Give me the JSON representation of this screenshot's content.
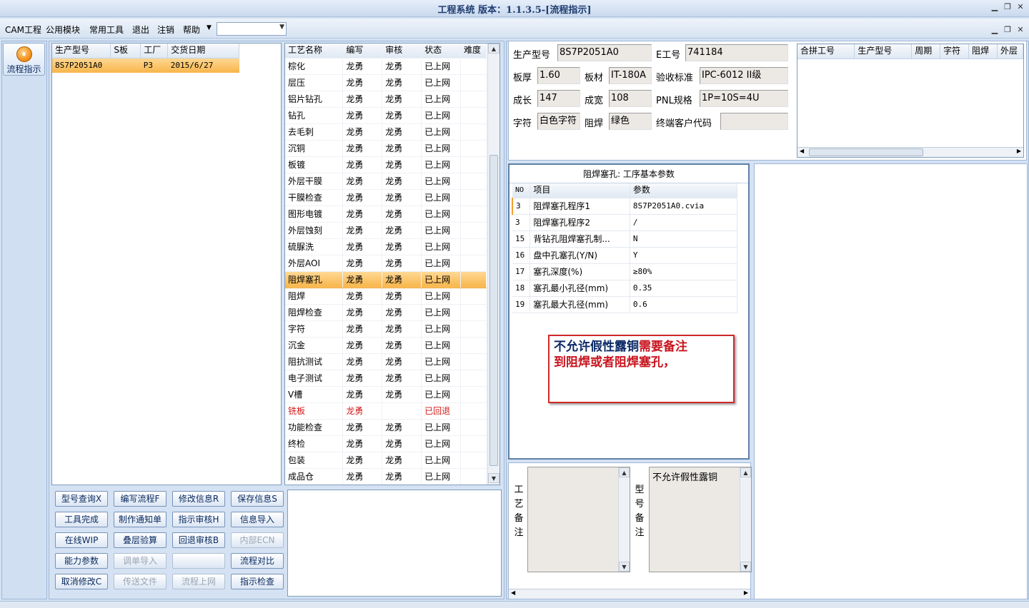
{
  "window": {
    "title": "工程系统  版本：1.1.3.5-[流程指示]"
  },
  "menu": {
    "items": [
      "CAM工程",
      "公用模块",
      "常用工具",
      "退出",
      "注销",
      "帮助"
    ],
    "combo_value": ""
  },
  "nav": {
    "button_label": "流程指示"
  },
  "orders": {
    "headers": [
      "生产型号",
      "S板",
      "工厂",
      "交货日期"
    ],
    "rows": [
      {
        "model": "8S7P2051A0",
        "s": "",
        "factory": "P3",
        "date": "2015/6/27"
      }
    ]
  },
  "process": {
    "headers": [
      "工艺名称",
      "编写",
      "审核",
      "状态",
      "难度"
    ],
    "rows": [
      {
        "name": "棕化",
        "author": "龙勇",
        "reviewer": "龙勇",
        "status": "已上网"
      },
      {
        "name": "层压",
        "author": "龙勇",
        "reviewer": "龙勇",
        "status": "已上网"
      },
      {
        "name": "铝片钻孔",
        "author": "龙勇",
        "reviewer": "龙勇",
        "status": "已上网"
      },
      {
        "name": "钻孔",
        "author": "龙勇",
        "reviewer": "龙勇",
        "status": "已上网"
      },
      {
        "name": "去毛刺",
        "author": "龙勇",
        "reviewer": "龙勇",
        "status": "已上网"
      },
      {
        "name": "沉铜",
        "author": "龙勇",
        "reviewer": "龙勇",
        "status": "已上网"
      },
      {
        "name": "板镀",
        "author": "龙勇",
        "reviewer": "龙勇",
        "status": "已上网"
      },
      {
        "name": "外层干膜",
        "author": "龙勇",
        "reviewer": "龙勇",
        "status": "已上网"
      },
      {
        "name": "干膜检查",
        "author": "龙勇",
        "reviewer": "龙勇",
        "status": "已上网"
      },
      {
        "name": "图形电镀",
        "author": "龙勇",
        "reviewer": "龙勇",
        "status": "已上网"
      },
      {
        "name": "外层蚀刻",
        "author": "龙勇",
        "reviewer": "龙勇",
        "status": "已上网"
      },
      {
        "name": "硫脲洗",
        "author": "龙勇",
        "reviewer": "龙勇",
        "status": "已上网"
      },
      {
        "name": "外层AOI",
        "author": "龙勇",
        "reviewer": "龙勇",
        "status": "已上网"
      },
      {
        "name": "阻焊塞孔",
        "author": "龙勇",
        "reviewer": "龙勇",
        "status": "已上网",
        "selected": true
      },
      {
        "name": "阻焊",
        "author": "龙勇",
        "reviewer": "龙勇",
        "status": "已上网"
      },
      {
        "name": "阻焊检查",
        "author": "龙勇",
        "reviewer": "龙勇",
        "status": "已上网"
      },
      {
        "name": "字符",
        "author": "龙勇",
        "reviewer": "龙勇",
        "status": "已上网"
      },
      {
        "name": "沉金",
        "author": "龙勇",
        "reviewer": "龙勇",
        "status": "已上网"
      },
      {
        "name": "阻抗测试",
        "author": "龙勇",
        "reviewer": "龙勇",
        "status": "已上网"
      },
      {
        "name": "电子测试",
        "author": "龙勇",
        "reviewer": "龙勇",
        "status": "已上网"
      },
      {
        "name": "V槽",
        "author": "龙勇",
        "reviewer": "龙勇",
        "status": "已上网"
      },
      {
        "name": "铣板",
        "author": "龙勇",
        "reviewer": "",
        "status": "已回退",
        "returned": true
      },
      {
        "name": "功能检查",
        "author": "龙勇",
        "reviewer": "龙勇",
        "status": "已上网"
      },
      {
        "name": "终检",
        "author": "龙勇",
        "reviewer": "龙勇",
        "status": "已上网"
      },
      {
        "name": "包装",
        "author": "龙勇",
        "reviewer": "龙勇",
        "status": "已上网"
      },
      {
        "name": "成品仓",
        "author": "龙勇",
        "reviewer": "龙勇",
        "status": "已上网"
      }
    ]
  },
  "buttons": [
    {
      "label": "型号查询X",
      "enabled": true
    },
    {
      "label": "编写流程F",
      "enabled": true
    },
    {
      "label": "修改信息R",
      "enabled": true
    },
    {
      "label": "保存信息S",
      "enabled": true
    },
    {
      "label": "工具完成",
      "enabled": true
    },
    {
      "label": "制作通知单",
      "enabled": true
    },
    {
      "label": "指示审核H",
      "enabled": true
    },
    {
      "label": "信息导入",
      "enabled": true
    },
    {
      "label": "在线WIP",
      "enabled": true
    },
    {
      "label": "叠层验算",
      "enabled": true
    },
    {
      "label": "回退审核B",
      "enabled": true
    },
    {
      "label": "内部ECN",
      "enabled": false
    },
    {
      "label": "能力参数",
      "enabled": true
    },
    {
      "label": "调单导入",
      "enabled": false
    },
    {
      "label": "",
      "enabled": false
    },
    {
      "label": "流程对比",
      "enabled": true
    },
    {
      "label": "取消修改C",
      "enabled": true
    },
    {
      "label": "传送文件",
      "enabled": false
    },
    {
      "label": "流程上网",
      "enabled": false
    },
    {
      "label": "指示检查",
      "enabled": true
    }
  ],
  "info": {
    "model_label": "生产型号",
    "model": "8S7P2051A0",
    "eno_label": "E工号",
    "eno": "741184",
    "thick_label": "板厚",
    "thick": "1.60",
    "material_label": "板材",
    "material": "IT-180A",
    "std_label": "验收标准",
    "std": "IPC-6012 II级",
    "len_label": "成长",
    "len": "147",
    "wid_label": "成宽",
    "wid": "108",
    "pnl_label": "PNL规格",
    "pnl": "1P=10S=4U",
    "char_label": "字符",
    "char": "白色字符",
    "mask_label": "阻焊",
    "mask": "绿色",
    "cust_label": "终端客户代码",
    "cust": ""
  },
  "combine": {
    "headers": [
      "合拼工号",
      "生产型号",
      "周期",
      "字符",
      "阻焊",
      "外层"
    ]
  },
  "params": {
    "title": "阻焊塞孔: 工序基本参数",
    "headers": [
      "NO",
      "项目",
      "参数"
    ],
    "rows": [
      {
        "no": "3",
        "item": "阻焊塞孔程序1",
        "value": "8S7P2051A0.cvia"
      },
      {
        "no": "3",
        "item": "阻焊塞孔程序2",
        "value": "/"
      },
      {
        "no": "15",
        "item": "背钻孔阻焊塞孔制...",
        "value": "N"
      },
      {
        "no": "16",
        "item": "盘中孔塞孔(Y/N)",
        "value": "Y"
      },
      {
        "no": "17",
        "item": "塞孔深度(%)",
        "value": "≥80%"
      },
      {
        "no": "18",
        "item": "塞孔最小孔径(mm)",
        "value": "0.35"
      },
      {
        "no": "19",
        "item": "塞孔最大孔径(mm)",
        "value": "0.6"
      }
    ]
  },
  "annotation": {
    "part1": "不允许假性露铜",
    "part2": "需要备注",
    "part3": "到阻焊或者阻焊塞孔，",
    "color_dark": "#0b2a66",
    "color_red": "#c8141e"
  },
  "notes": {
    "process_label": "工艺备注",
    "process_text": "",
    "model_label": "型号备注",
    "model_text": "不允许假性露铜"
  }
}
